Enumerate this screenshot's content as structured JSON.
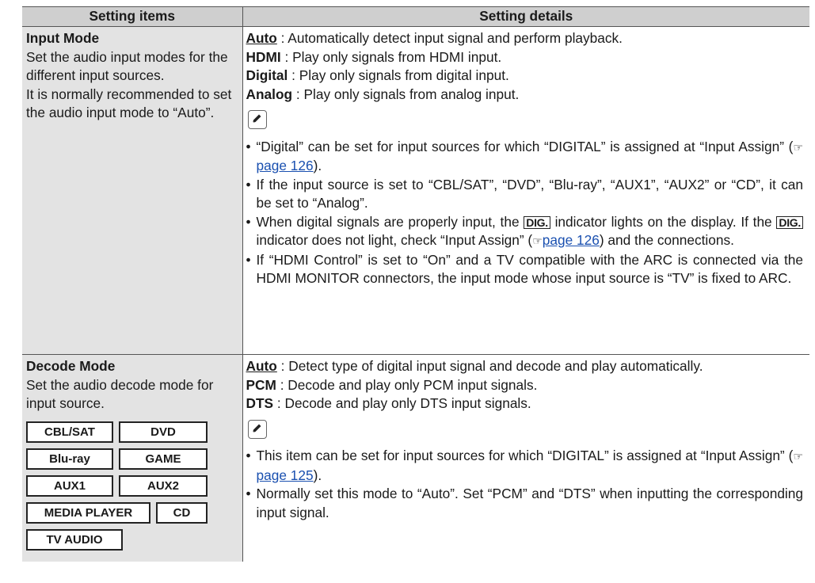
{
  "header": {
    "col1": "Setting items",
    "col2": "Setting details"
  },
  "row1": {
    "title": "Input Mode",
    "desc1": "Set the audio input modes for the different input sources.",
    "desc2": "It is normally recommended to set the audio input mode to “Auto”.",
    "options": [
      {
        "name": "Auto",
        "desc": " : Automatically detect input signal and perform playback."
      },
      {
        "name": "HDMI",
        "desc": " : Play only signals from HDMI input."
      },
      {
        "name": "Digital",
        "desc": " : Play only signals from digital input."
      },
      {
        "name": "Analog",
        "desc": " : Play only signals from analog input."
      }
    ],
    "notes": {
      "n1a": "“Digital” can be set for input sources for which “DIGITAL” is assigned at “Input Assign” (",
      "n1link": "page 126",
      "n1b": ").",
      "n2": "If the input source is set to “CBL/SAT”, “DVD”, “Blu-ray”, “AUX1”, “AUX2” or “CD”, it can be set to “Analog”.",
      "n3a": "When digital signals are properly input, the ",
      "dig": "DIG.",
      "n3b": " indicator lights on the display. If the ",
      "n3c": " indicator does not light, check “Input Assign” (",
      "n3link": "page 126",
      "n3d": ") and the connections.",
      "n4": "If “HDMI Control” is set to “On” and a TV compatible with the ARC is connected via the HDMI MONITOR connectors, the input mode whose input source is “TV” is fixed to ARC."
    }
  },
  "row2": {
    "title": "Decode Mode",
    "desc": "Set the audio decode mode for input source.",
    "sources": [
      "CBL/SAT",
      "DVD",
      "Blu-ray",
      "GAME",
      "AUX1",
      "AUX2",
      "MEDIA PLAYER",
      "CD",
      "TV AUDIO"
    ],
    "options": [
      {
        "name": "Auto",
        "desc": " : Detect type of digital input signal and decode and play automatically."
      },
      {
        "name": "PCM",
        "desc": " : Decode and play only PCM input signals."
      },
      {
        "name": "DTS",
        "desc": " : Decode and play only DTS input signals."
      }
    ],
    "notes": {
      "n1a": "This item can be set for input sources for which “DIGITAL” is assigned at “Input Assign” (",
      "n1link": "page 125",
      "n1b": ").",
      "n2": "Normally set this mode to “Auto”. Set “PCM” and “DTS” when inputting the corresponding input signal."
    }
  },
  "icons": {
    "note": "pencil-icon",
    "page_ref": "hand-pointer-icon"
  },
  "colors": {
    "header_bg": "#cfcfcf",
    "item_bg": "#e3e3e3",
    "link": "#1a50b0"
  }
}
